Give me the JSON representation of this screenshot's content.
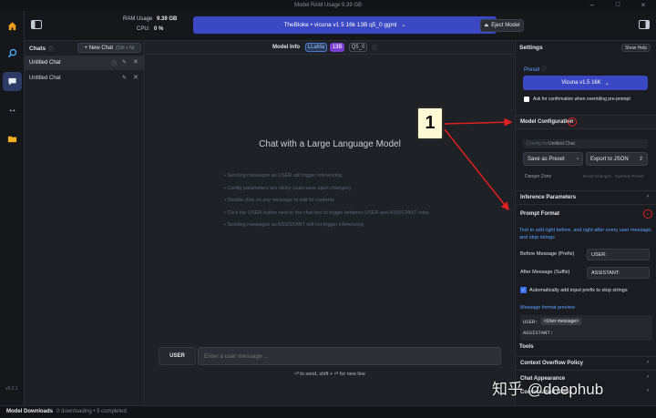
{
  "titlebar": {
    "title": "Model RAM Usage  9.39 GB"
  },
  "topbar": {
    "ram_label": "RAM Usage",
    "ram_value": "9.39 GB",
    "cpu_label": "CPU:",
    "cpu_value": "0 %",
    "model_selected": "TheBloke • vicuna v1 5 16k 13B q5_0 ggml",
    "eject_label": "Eject Model"
  },
  "chats": {
    "header": "Chats",
    "new_chat_label": "+ New Chat",
    "new_chat_shortcut": "(Ctrl + N)",
    "items": [
      {
        "label": "Untitled Chat"
      },
      {
        "label": "Untitled Chat"
      }
    ],
    "version": "v0.2.1"
  },
  "main": {
    "model_info_label": "Model Info",
    "badges": [
      "LLaMa",
      "13B",
      "Q5_0"
    ],
    "heading": "Chat with a Large Language Model",
    "tips": [
      "Sending messages as USER will trigger inferencing",
      "Config parameters are sticky (auto-save upon changes)",
      "Double click on any message to edit its contents",
      "Click the USER button next to the chat box to toggle between USER and ASSISTANT roles",
      "Sending messages as ASSISTANT will not trigger inferencing"
    ],
    "role_button": "USER",
    "input_placeholder": "Enter a user message ...",
    "send_hint": "⏎ to send, shift + ⏎ for new line"
  },
  "settings": {
    "title": "Settings",
    "show_help": "Show Help",
    "preset_label": "Preset",
    "preset_value": "Vicuna v1.5 16K",
    "confirm_label": "Ask for confirmation when overriding pre-prompt",
    "model_config": "Model Configuration",
    "config_for_label": "Config for",
    "config_for_value": "Untitled Chat",
    "save_preset": "Save as Preset",
    "export_json": "Export to JSON",
    "danger_zone": "Danger Zone",
    "reset_changes": "Reset Changes",
    "override_preset": "Override Preset",
    "inference_params": "Inference Parameters",
    "prompt_format": "Prompt Format",
    "prompt_format_desc": "Text to add right before, and right after every user message, and stop strings",
    "before_label": "Before Message (Prefix)",
    "before_value": "USER:",
    "after_label": "After Message (Suffix)",
    "after_value": "ASSISTANT:",
    "auto_add_label": "Automatically add input prefix to stop strings",
    "preview_label": "Message format preview",
    "preview_user": "USER:",
    "preview_msg": "<User message>",
    "preview_assistant": "ASSISTANT:",
    "tools": "Tools",
    "context_overflow": "Context Overflow Policy",
    "chat_appearance": "Chat Appearance",
    "conversation_notes": "Conversation Notes"
  },
  "annotation": {
    "number": "1"
  },
  "watermark": "知乎 @deephub",
  "statusbar": {
    "title": "Model Downloads",
    "downloading": "0 downloading",
    "completed": "5 completed"
  },
  "colors": {
    "accent": "#3a48c4",
    "purple": "#7b3fd6",
    "arrow": "#e0201f",
    "callout_bg": "#fff9d6"
  },
  "icons": [
    "home-icon",
    "search-icon",
    "chat-icon",
    "swap-icon",
    "folder-icon",
    "sidebar-toggle-icon"
  ]
}
